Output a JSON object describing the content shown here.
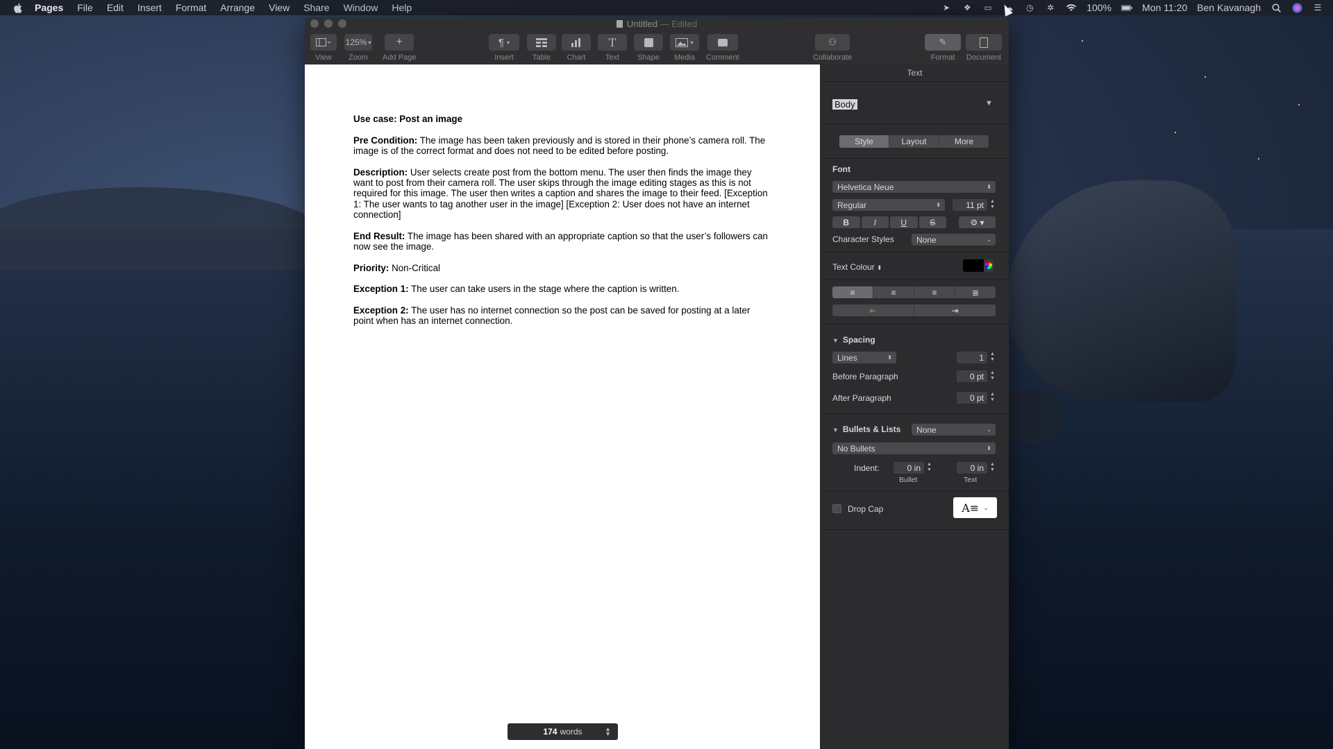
{
  "menubar": {
    "app": "Pages",
    "items": [
      "File",
      "Edit",
      "Insert",
      "Format",
      "Arrange",
      "View",
      "Share",
      "Window",
      "Help"
    ],
    "battery": "100%",
    "clock": "Mon 11:20",
    "user": "Ben Kavanagh"
  },
  "window": {
    "title": "Untitled",
    "status": "— Edited"
  },
  "toolbar": {
    "view": "View",
    "zoom_value": "125%",
    "zoom": "Zoom",
    "add_page": "Add Page",
    "insert": "Insert",
    "table": "Table",
    "chart": "Chart",
    "text": "Text",
    "shape": "Shape",
    "media": "Media",
    "comment": "Comment",
    "collaborate": "Collaborate",
    "format": "Format",
    "document": "Document"
  },
  "document": {
    "title": "Use case: Post an image",
    "paragraphs": [
      {
        "label": "Pre Condition:",
        "text": " The image has been taken previously and is stored in their phone’s camera roll. The image is of the correct format and does not need to be edited before posting."
      },
      {
        "label": "Description:",
        "text": " User selects create post from the bottom menu.  The user then finds the image they want to post from their camera roll.  The user skips through the image editing stages as this is not required for this image.  The user then writes a caption and shares the image to their feed. [Exception 1: The user wants to tag another user in the image] [Exception 2: User does not have an internet connection]"
      },
      {
        "label": "End Result:",
        "text": " The image has been shared with an appropriate caption so that the user’s followers can now see the image."
      },
      {
        "label": "Priority:",
        "text": " Non-Critical"
      },
      {
        "label": "Exception 1:",
        "text": " The user can take users in the stage where the caption is written."
      },
      {
        "label": "Exception 2:",
        "text": " The user has no internet connection so the post can be saved for posting at a later point when has an internet connection."
      }
    ],
    "word_count": "174",
    "word_unit": "words"
  },
  "inspector": {
    "header": "Text",
    "paragraph_style": "Body",
    "tabs": [
      "Style",
      "Layout",
      "More"
    ],
    "active_tab": "Style",
    "font_label": "Font",
    "font_family": "Helvetica Neue",
    "font_weight": "Regular",
    "font_size": "11 pt",
    "bold": "B",
    "italic": "I",
    "underline": "U",
    "strike": "S",
    "char_styles_label": "Character Styles",
    "char_styles_value": "None",
    "text_colour_label": "Text Colour",
    "text_colour": "#000000",
    "spacing_label": "Spacing",
    "spacing_mode": "Lines",
    "spacing_value": "1",
    "before_label": "Before Paragraph",
    "before_value": "0 pt",
    "after_label": "After Paragraph",
    "after_value": "0 pt",
    "bullets_label": "Bullets & Lists",
    "bullets_value": "None",
    "bullet_style": "No Bullets",
    "indent_label": "Indent:",
    "bullet_indent": "0 in",
    "text_indent": "0 in",
    "bullet_caption": "Bullet",
    "text_caption": "Text",
    "drop_cap_label": "Drop Cap"
  }
}
